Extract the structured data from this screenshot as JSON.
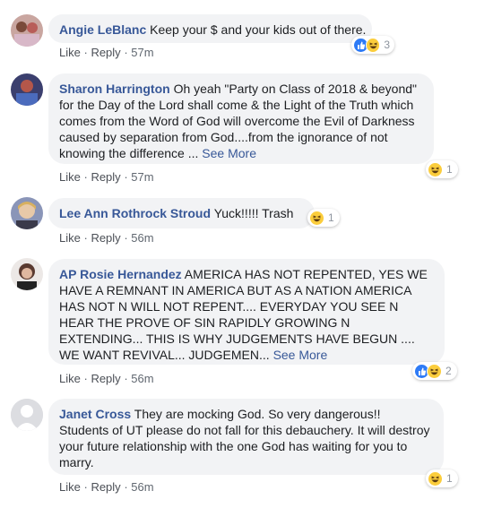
{
  "comments": [
    {
      "author": "Angie LeBlanc",
      "text": "Keep your $ and your kids out of there.",
      "actions": {
        "like": "Like",
        "reply": "Reply",
        "time": "57m"
      },
      "reactions": {
        "icons": [
          "like-icon",
          "haha-icon"
        ],
        "count": "3"
      }
    },
    {
      "author": "Sharon Harrington",
      "text": "Oh yeah \"Party on Class of 2018 & beyond\" for the Day of the Lord shall come & the Light of the Truth which comes from the Word of God will overcome the Evil of Darkness caused by separation from God....from the ignorance of not knowing the difference ...",
      "see_more": "See More",
      "actions": {
        "like": "Like",
        "reply": "Reply",
        "time": "57m"
      },
      "reactions": {
        "icons": [
          "haha-icon"
        ],
        "count": "1"
      }
    },
    {
      "author": "Lee Ann Rothrock Stroud",
      "text": "Yuck!!!!! Trash",
      "actions": {
        "like": "Like",
        "reply": "Reply",
        "time": "56m"
      },
      "reactions": {
        "icons": [
          "haha-icon"
        ],
        "count": "1"
      }
    },
    {
      "author": "AP Rosie Hernandez",
      "text": "AMERICA HAS NOT REPENTED, YES WE HAVE A REMNANT IN AMERICA BUT AS A NATION AMERICA HAS NOT N WILL NOT REPENT.... EVERYDAY YOU SEE N HEAR THE PROVE OF SIN RAPIDLY GROWING N EXTENDING... THIS IS WHY JUDGEMENTS HAVE BEGUN .... WE WANT REVIVAL... JUDGEMEN...",
      "see_more": "See More",
      "actions": {
        "like": "Like",
        "reply": "Reply",
        "time": "56m"
      },
      "reactions": {
        "icons": [
          "like-icon",
          "haha-icon"
        ],
        "count": "2"
      }
    },
    {
      "author": "Janet Cross",
      "text": "They are mocking God. So very dangerous!! Students of UT please do not fall for this debauchery. It will destroy your future relationship with the one God has waiting for you to marry.",
      "actions": {
        "like": "Like",
        "reply": "Reply",
        "time": "56m"
      },
      "reactions": {
        "icons": [
          "haha-icon"
        ],
        "count": "1"
      }
    }
  ],
  "colors": {
    "author": "#385898",
    "bubble": "#f2f3f5",
    "like": "#2e7bf6",
    "haha": "#fbcd3c"
  }
}
